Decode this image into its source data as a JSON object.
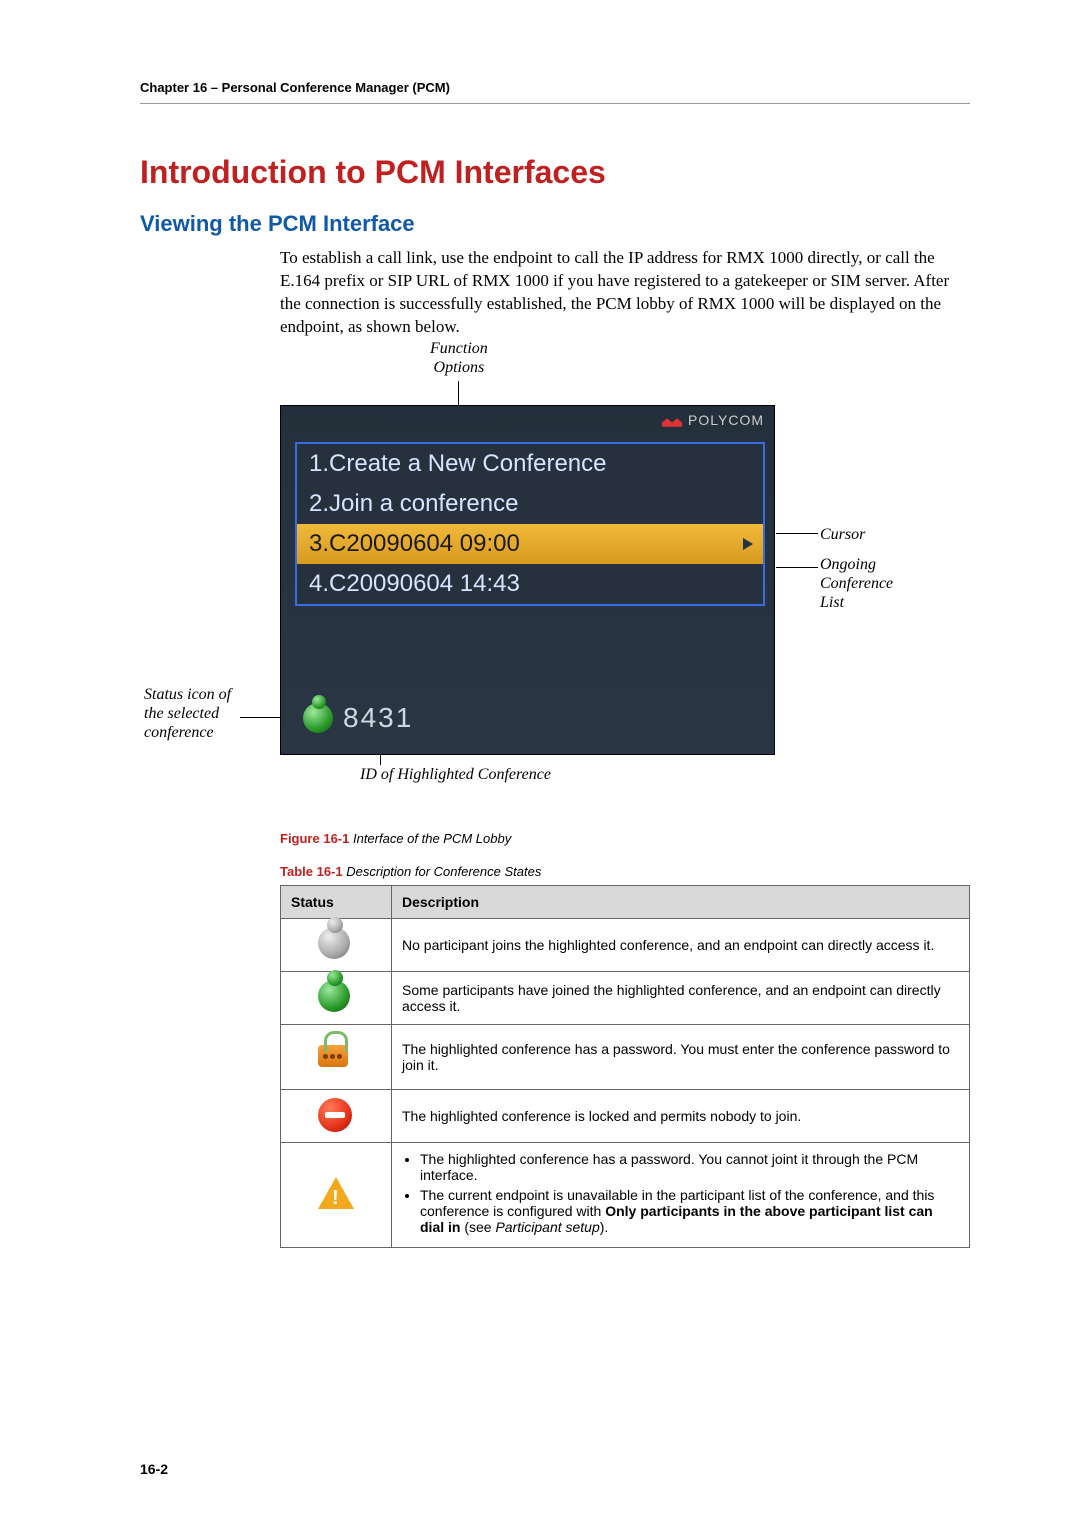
{
  "header": {
    "chapter_line": "Chapter 16 – Personal Conference Manager (PCM)"
  },
  "titles": {
    "h1": "Introduction to PCM Interfaces",
    "h2": "Viewing the PCM Interface"
  },
  "intro_paragraph": "To establish a call link, use the endpoint to call the IP address for RMX 1000 directly, or call the E.164 prefix or SIP URL of RMX 1000 if you have registered to a gatekeeper or SIM server. After the connection is successfully established, the PCM lobby of RMX 1000 will be displayed on the endpoint, as shown below.",
  "callouts": {
    "function_options": "Function\nOptions",
    "cursor": "Cursor",
    "ongoing_list": "Ongoing\nConference\nList",
    "status_icon": "Status icon of\nthe selected\nconference",
    "id_highlighted": "ID of Highlighted Conference"
  },
  "screenshot": {
    "brand": "POLYCOM",
    "items": [
      "1.Create a New Conference",
      "2.Join a conference",
      "3.C20090604 09:00",
      "4.C20090604 14:43"
    ],
    "highlighted_index": 2,
    "status_id": "8431"
  },
  "figure_caption": {
    "bold": "Figure 16-1",
    "ital": " Interface of the PCM Lobby"
  },
  "table_caption": {
    "bold": "Table 16-1",
    "ital": " Description for Conference States"
  },
  "table": {
    "headers": {
      "status": "Status",
      "desc": "Description"
    },
    "rows": [
      {
        "icon": "person-grey",
        "desc": "No participant joins the highlighted conference, and an endpoint can directly access it."
      },
      {
        "icon": "person-green",
        "desc": "Some participants have joined the highlighted conference, and an endpoint can directly access it."
      },
      {
        "icon": "lock",
        "desc": "The highlighted conference has a password. You must enter the conference password to join it."
      },
      {
        "icon": "nojoin",
        "desc": "The highlighted conference is locked and permits nobody to join."
      },
      {
        "icon": "warn",
        "list": [
          {
            "text": "The highlighted conference has a password. You cannot joint it through the PCM interface."
          },
          {
            "prefix": "The current endpoint is unavailable in the participant list of the conference, and this conference is configured with ",
            "bold": "Only participants in the above participant list can dial in",
            "tail": " (see ",
            "ital": "Participant setup",
            "tail2": ")."
          }
        ]
      }
    ]
  },
  "page_number": "16-2"
}
